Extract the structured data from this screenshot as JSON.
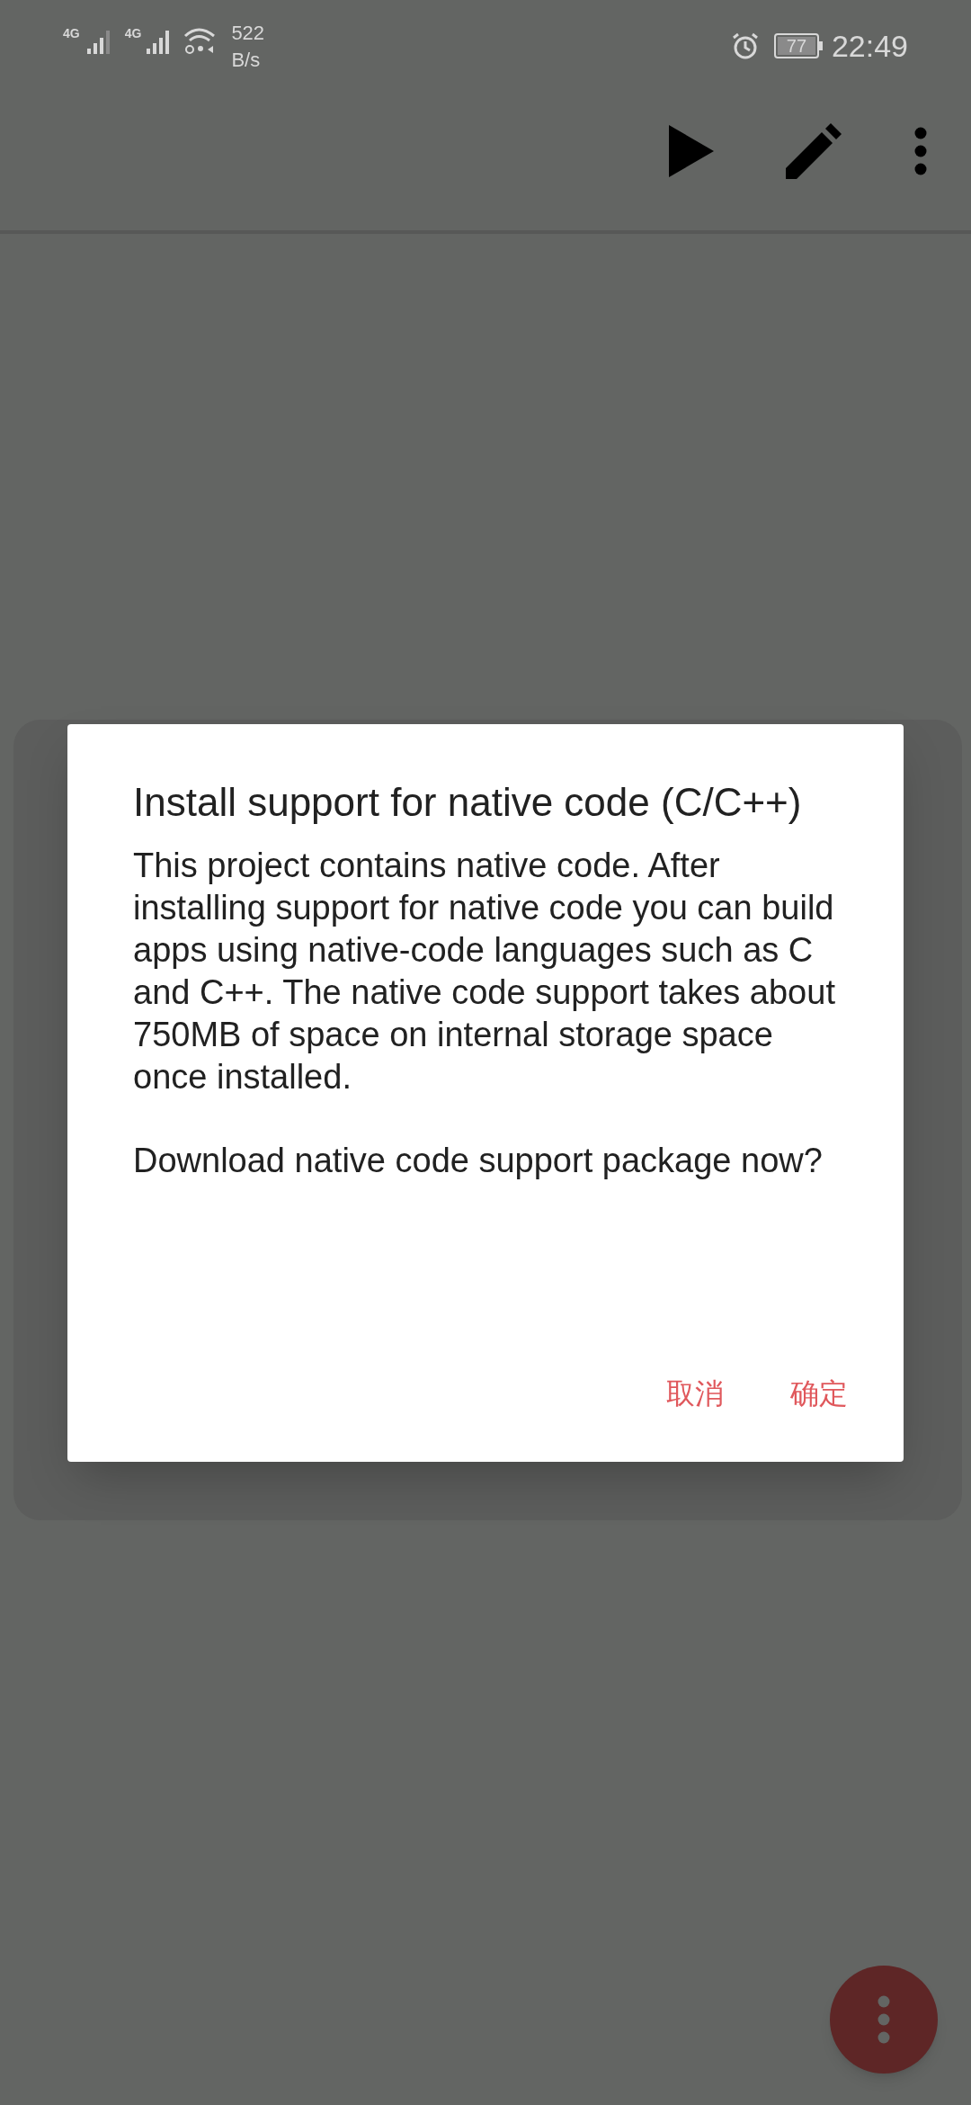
{
  "status_bar": {
    "network_1": "4G",
    "network_2": "4G",
    "speed_value": "522",
    "speed_unit": "B/s",
    "battery": "77",
    "time": "22:49"
  },
  "dialog": {
    "title": "Install support for native code (C/C++)",
    "paragraphs": [
      "This project contains native code. After installing support for native code you can build apps using native-code languages such as C and C++. The native code support takes about 750MB of space on internal storage space once installed.",
      "Download native code support package now?"
    ],
    "buttons": [
      "取消",
      "确定"
    ]
  }
}
